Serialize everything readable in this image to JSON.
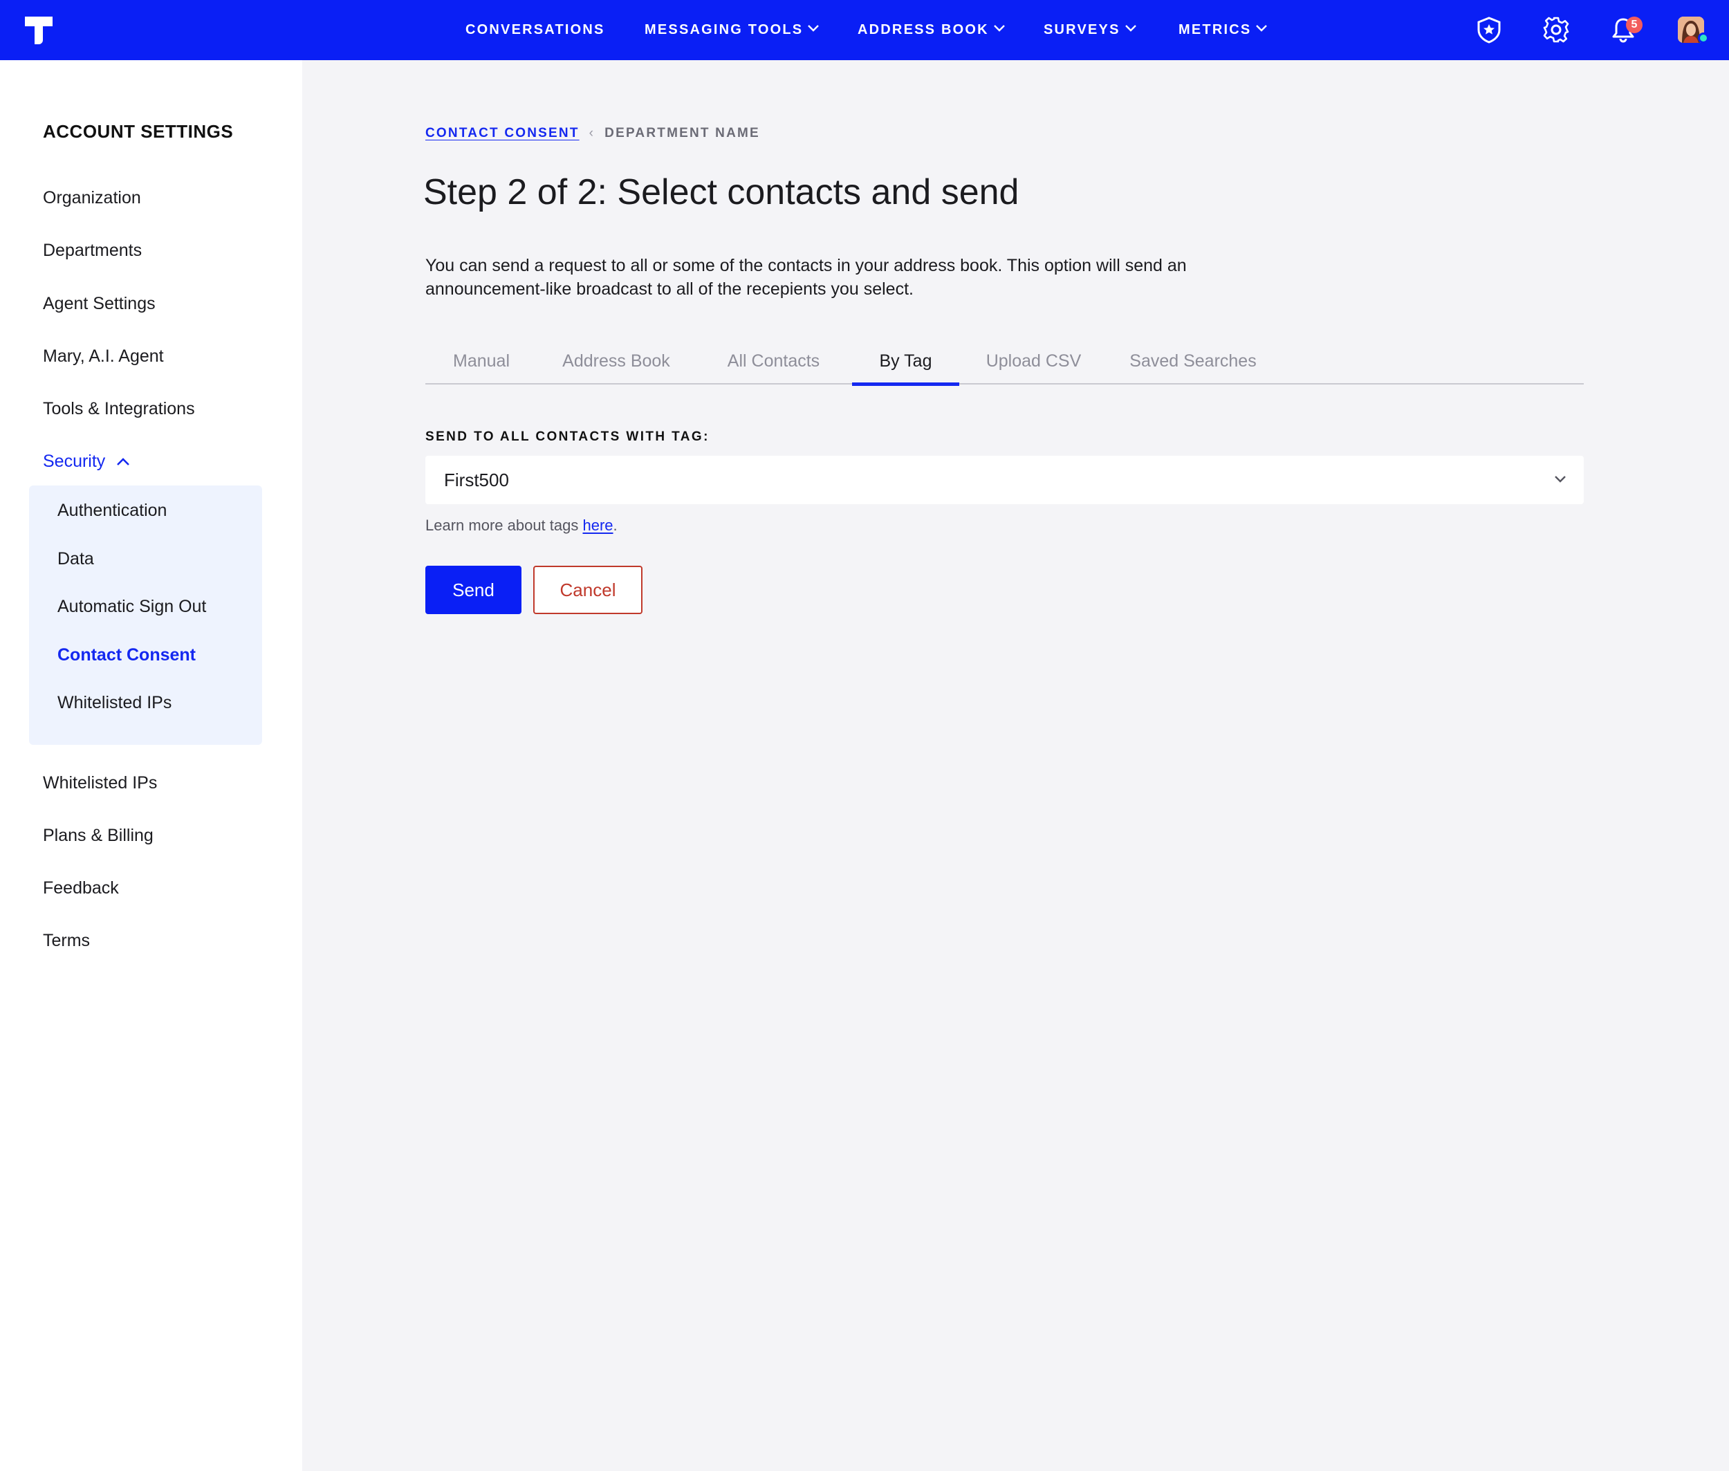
{
  "nav": {
    "items": [
      {
        "label": "CONVERSATIONS",
        "dropdown": false
      },
      {
        "label": "MESSAGING TOOLS",
        "dropdown": true
      },
      {
        "label": "ADDRESS BOOK",
        "dropdown": true
      },
      {
        "label": "SURVEYS",
        "dropdown": true
      },
      {
        "label": "METRICS",
        "dropdown": true
      }
    ],
    "notification_count": "5",
    "icons": [
      "logo-icon",
      "shield-star-icon",
      "gear-icon",
      "bell-icon",
      "avatar"
    ]
  },
  "sidebar": {
    "heading": "ACCOUNT SETTINGS",
    "items": [
      {
        "label": "Organization"
      },
      {
        "label": "Departments"
      },
      {
        "label": "Agent Settings"
      },
      {
        "label": "Mary, A.I. Agent"
      },
      {
        "label": "Tools & Integrations"
      },
      {
        "label": "Security"
      },
      {
        "label": "Whitelisted IPs"
      },
      {
        "label": "Plans & Billing"
      },
      {
        "label": "Feedback"
      },
      {
        "label": "Terms"
      }
    ],
    "security_subitems": [
      {
        "label": "Authentication"
      },
      {
        "label": "Data"
      },
      {
        "label": "Automatic Sign Out"
      },
      {
        "label": "Contact Consent",
        "active": true
      },
      {
        "label": "Whitelisted IPs"
      }
    ]
  },
  "breadcrumb": {
    "link": "CONTACT CONSENT",
    "separator": "‹",
    "current": "DEPARTMENT NAME"
  },
  "page": {
    "title": "Step 2 of 2: Select contacts and send",
    "description": "You can send a request to all or some of the contacts in your address book. This option will send an announcement-like broadcast to all of the recepients you select."
  },
  "tabs": [
    {
      "label": "Manual"
    },
    {
      "label": "Address Book"
    },
    {
      "label": "All Contacts"
    },
    {
      "label": "By Tag",
      "active": true
    },
    {
      "label": "Upload CSV"
    },
    {
      "label": "Saved Searches"
    }
  ],
  "form": {
    "tag_label": "SEND TO ALL CONTACTS WITH TAG:",
    "tag_value": "First500",
    "helper_text": "Learn more about tags ",
    "helper_link": "here",
    "helper_period": ".",
    "send_label": "Send",
    "cancel_label": "Cancel"
  },
  "colors": {
    "brand_blue": "#0a1ff5",
    "link_blue": "#1428f0",
    "cancel_red": "#c0392b",
    "badge_red": "#f25c5c",
    "online_green": "#2ee6c7"
  }
}
